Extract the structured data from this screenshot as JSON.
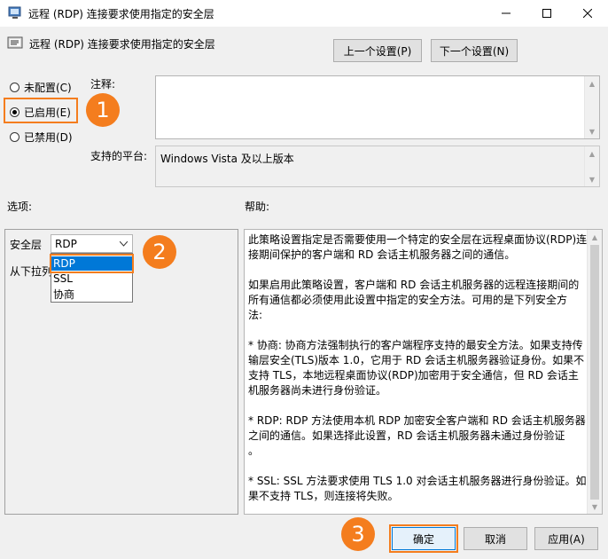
{
  "window": {
    "title": "远程 (RDP) 连接要求使用指定的安全层",
    "minimize": "—",
    "maximize": "☐",
    "close": "✕"
  },
  "header": {
    "policy_title": "远程 (RDP) 连接要求使用指定的安全层",
    "prev_button": "上一个设置(P)",
    "next_button": "下一个设置(N)"
  },
  "state": {
    "options": [
      {
        "label": "未配置(C)",
        "selected": false
      },
      {
        "label": "已启用(E)",
        "selected": true
      },
      {
        "label": "已禁用(D)",
        "selected": false
      }
    ]
  },
  "comment": {
    "label": "注释:"
  },
  "platform": {
    "label": "支持的平台:",
    "value": "Windows Vista 及以上版本"
  },
  "options_section": {
    "header": "选项:",
    "security_layer_label": "安全层",
    "security_layer_value": "RDP",
    "dropdown_options": [
      "RDP",
      "SSL",
      "协商"
    ],
    "partial_text": "从下拉列"
  },
  "help_section": {
    "header": "帮助:",
    "lines": [
      "此策略设置指定是否需要使用一个特定的安全层在远程桌面协议(RDP)连",
      "接期间保护的客户端和 RD 会话主机服务器之间的通信。",
      "",
      "如果启用此策略设置，客户端和 RD 会话主机服务器的远程连接期间的",
      "所有通信都必须使用此设置中指定的安全方法。可用的是下列安全方",
      "法:",
      "",
      " * 协商: 协商方法强制执行的客户端程序支持的最安全方法。如果支持传",
      "输层安全(TLS)版本 1.0，它用于 RD 会话主机服务器验证身份。如果不",
      "支持 TLS，本地远程桌面协议(RDP)加密用于安全通信，但 RD 会话主",
      "机服务器尚未进行身份验证。",
      "",
      " * RDP: RDP 方法使用本机 RDP 加密安全客户端和 RD 会话主机服务器",
      "之间的通信。如果选择此设置，RD 会话主机服务器未通过身份验证",
      "。",
      "",
      " * SSL: SSL 方法要求使用 TLS 1.0 对会话主机服务器进行身份验证。如",
      "果不支持 TLS，则连接将失败。"
    ]
  },
  "footer": {
    "ok_button": "确定",
    "cancel_button": "取消",
    "apply_button": "应用(A)"
  },
  "annotations": {
    "badge1": "1",
    "badge2": "2",
    "badge3": "3",
    "accent_color": "#f47d1e"
  }
}
